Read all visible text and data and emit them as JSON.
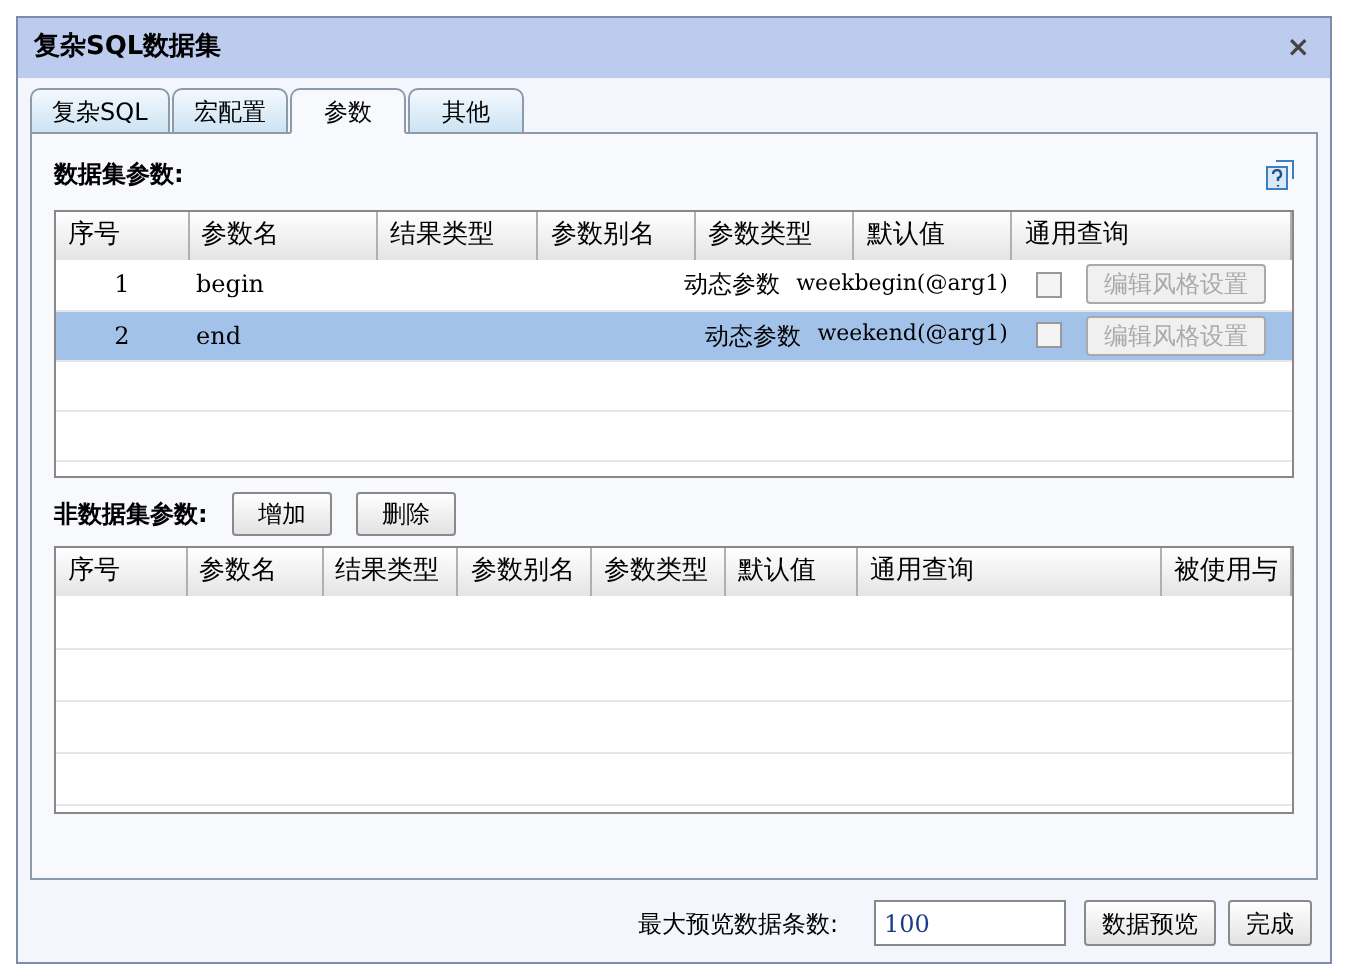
{
  "window": {
    "title": "复杂SQL数据集",
    "close": "×"
  },
  "tabs": [
    {
      "label": "复杂SQL",
      "selected": false
    },
    {
      "label": "宏配置",
      "selected": false
    },
    {
      "label": "参数",
      "selected": true
    },
    {
      "label": "其他",
      "selected": false
    }
  ],
  "dataset_params": {
    "title": "数据集参数:",
    "columns": [
      "序号",
      "参数名",
      "结果类型",
      "参数别名",
      "参数类型",
      "默认值",
      "通用查询"
    ],
    "rows": [
      {
        "index": "1",
        "name": "begin",
        "param_type": "动态参数",
        "default": "weekbegin(@arg1)",
        "checked": false,
        "selected": false,
        "button": "编辑风格设置"
      },
      {
        "index": "2",
        "name": "end",
        "param_type": "动态参数",
        "default": "weekend(@arg1)",
        "checked": false,
        "selected": true,
        "button": "编辑风格设置"
      }
    ]
  },
  "other_params": {
    "title": "非数据集参数:",
    "buttons": [
      "增加",
      "删除"
    ],
    "columns": [
      "序号",
      "参数名",
      "结果类型",
      "参数别名",
      "参数类型",
      "默认值",
      "通用查询",
      "被使用与"
    ]
  },
  "footer": {
    "label": "最大预览数据条数:",
    "value": "100",
    "buttons": [
      "数据预览",
      "完成"
    ]
  }
}
